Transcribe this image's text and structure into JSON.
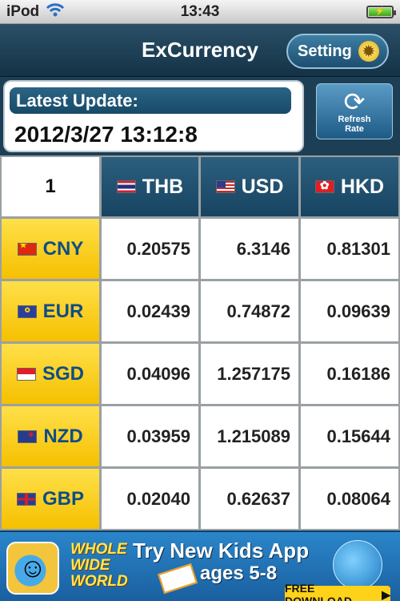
{
  "status_bar": {
    "carrier": "iPod",
    "wifi_icon": "wifi-icon",
    "time": "13:43",
    "battery_icon": "battery-charging-icon"
  },
  "nav": {
    "title": "ExCurrency",
    "setting_label": "Setting",
    "setting_icon": "gear-icon"
  },
  "update": {
    "label": "Latest Update:",
    "value": "2012/3/27 13:12:8",
    "refresh_line1": "Refresh",
    "refresh_line2": "Rate",
    "refresh_icon": "refresh-icon"
  },
  "table": {
    "amount": "1",
    "columns": [
      {
        "code": "THB",
        "flag": "thailand-flag-icon"
      },
      {
        "code": "USD",
        "flag": "usa-flag-icon"
      },
      {
        "code": "HKD",
        "flag": "hong-kong-flag-icon"
      }
    ],
    "rows": [
      {
        "code": "CNY",
        "flag": "china-flag-icon",
        "values": [
          "0.20575",
          "6.3146",
          "0.81301"
        ]
      },
      {
        "code": "EUR",
        "flag": "eu-flag-icon",
        "values": [
          "0.02439",
          "0.74872",
          "0.09639"
        ]
      },
      {
        "code": "SGD",
        "flag": "singapore-flag-icon",
        "values": [
          "0.04096",
          "1.257175",
          "0.16186"
        ]
      },
      {
        "code": "NZD",
        "flag": "new-zealand-flag-icon",
        "values": [
          "0.03959",
          "1.215089",
          "0.15644"
        ]
      },
      {
        "code": "GBP",
        "flag": "uk-flag-icon",
        "values": [
          "0.02040",
          "0.62637",
          "0.08064"
        ]
      }
    ],
    "colors": {
      "header_bg": "#1d5676",
      "row_head_bg": "#f7c800",
      "row_head_text": "#0f4d86"
    }
  },
  "ad": {
    "brand_line1": "WHOLE",
    "brand_line2": "WIDE",
    "brand_line3": "WORLD",
    "headline": "Try New Kids App",
    "subline": "ages 5-8",
    "cta": "FREE DOWNLOAD",
    "cta_icon": "arrow-right-icon"
  }
}
